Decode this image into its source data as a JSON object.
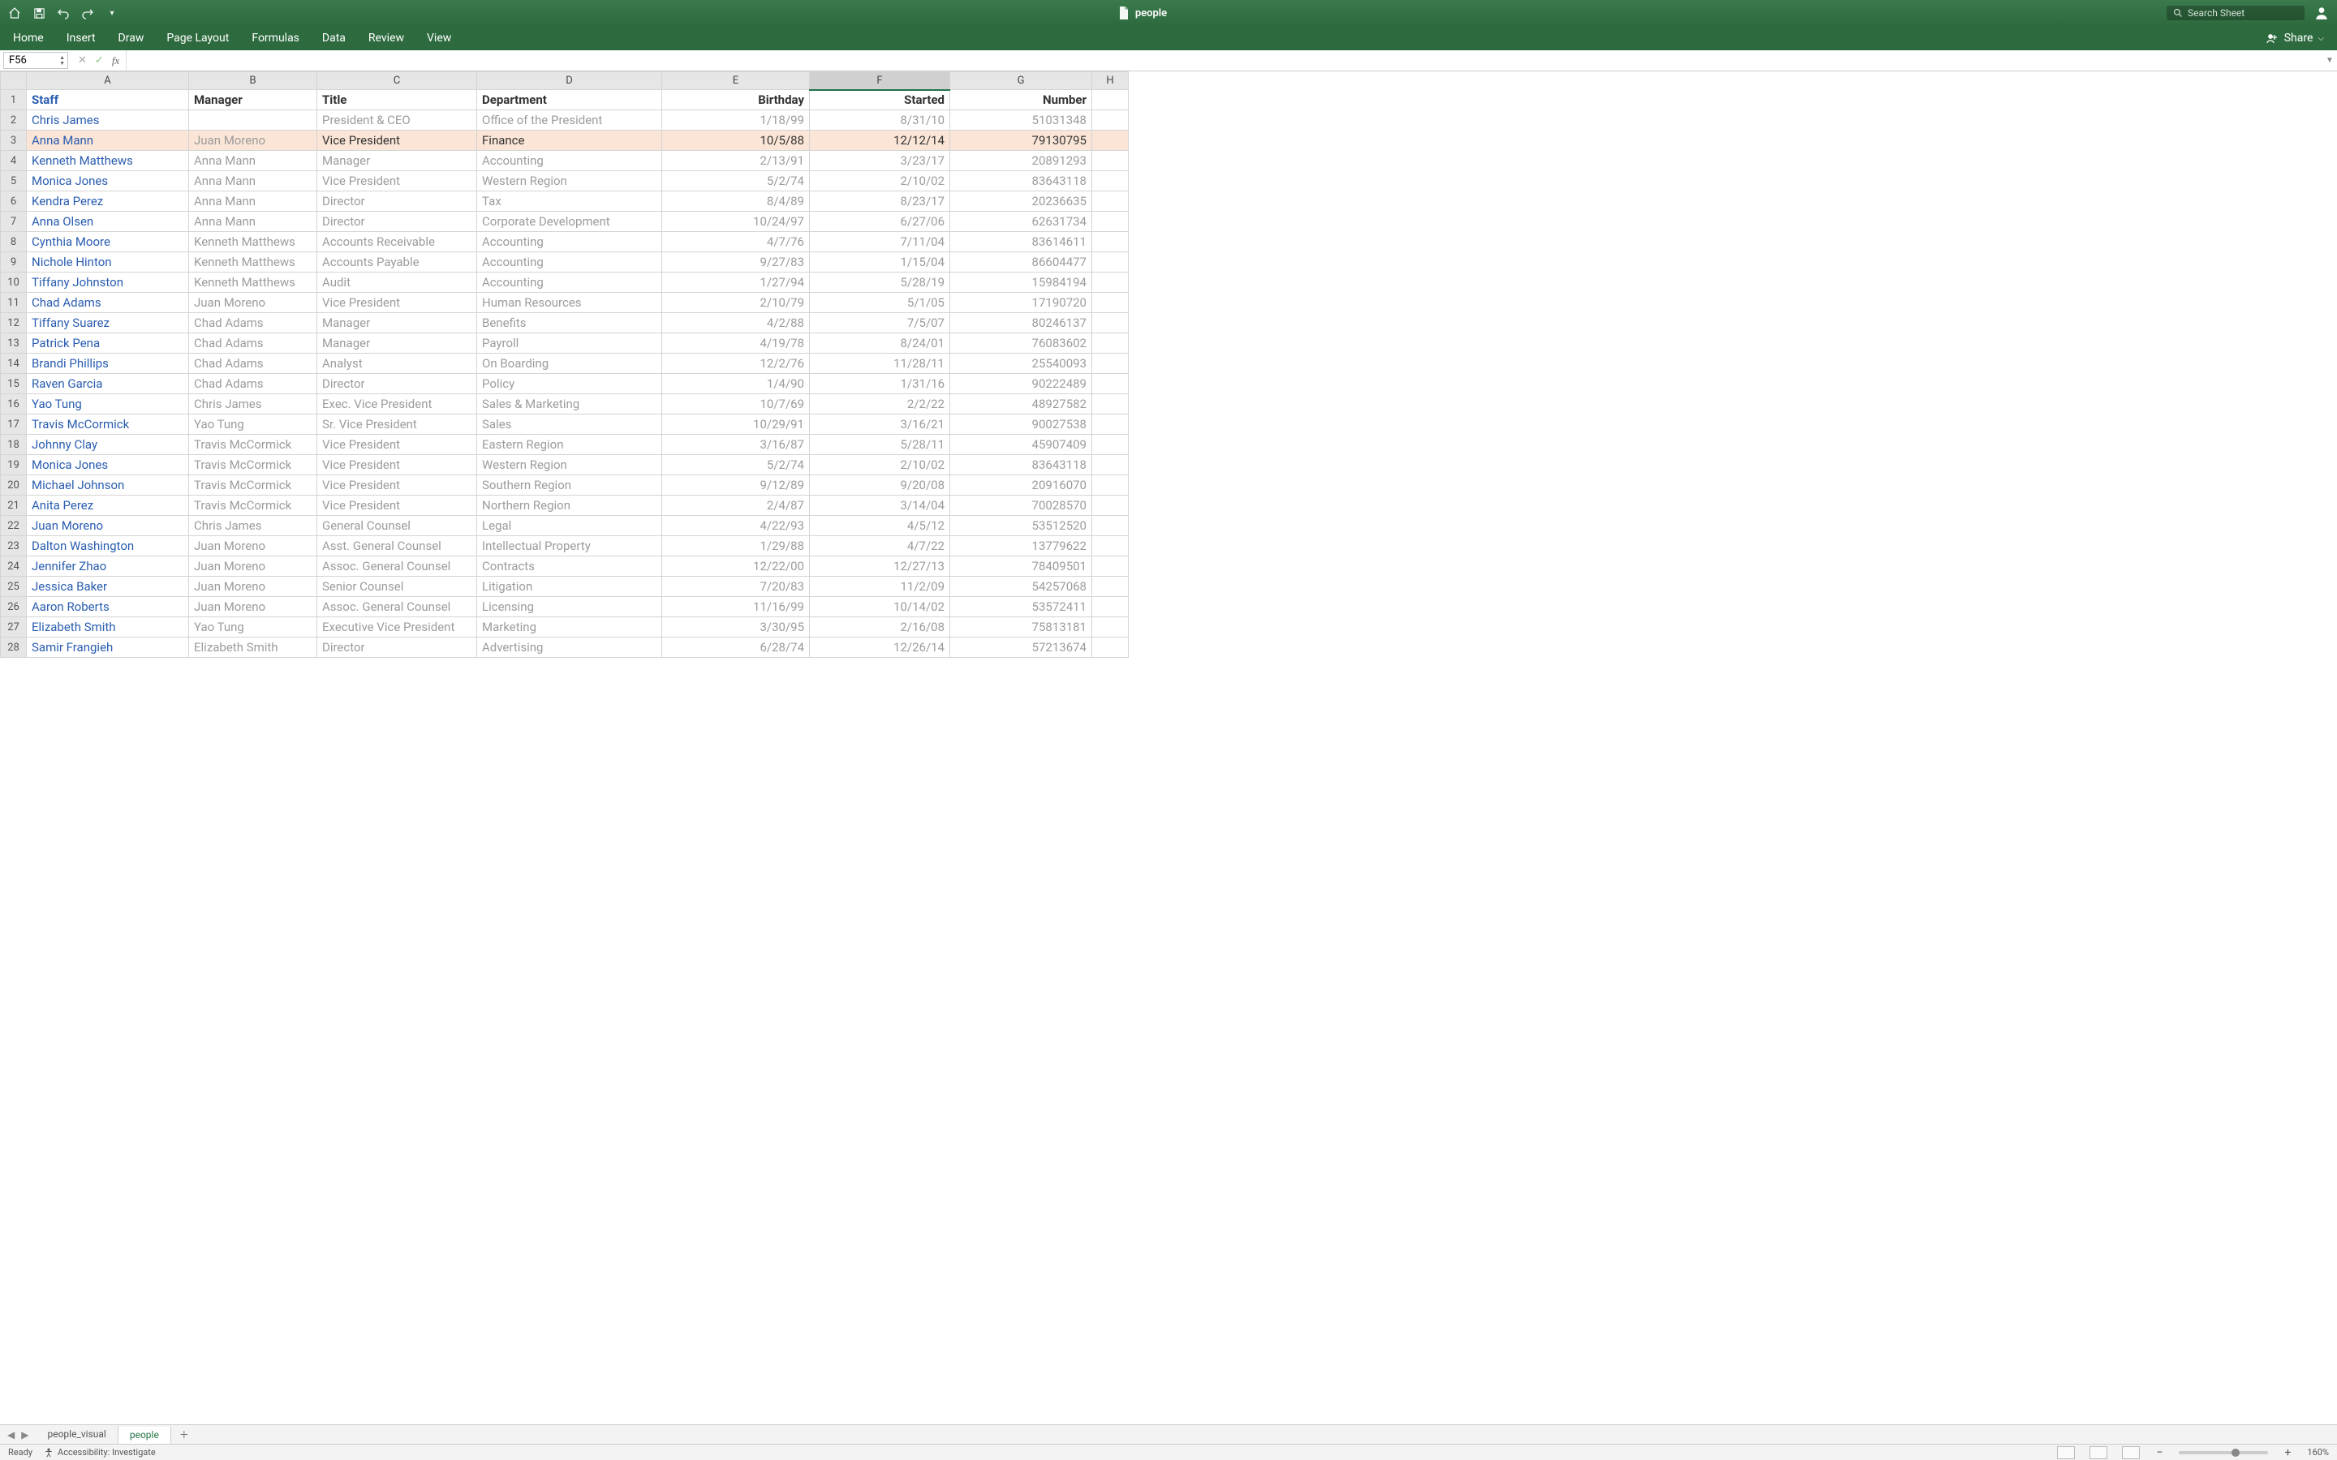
{
  "title": "people",
  "search_placeholder": "Search Sheet",
  "ribbon": [
    "Home",
    "Insert",
    "Draw",
    "Page Layout",
    "Formulas",
    "Data",
    "Review",
    "View"
  ],
  "share_label": "Share",
  "name_box": "F56",
  "columns": [
    "A",
    "B",
    "C",
    "D",
    "E",
    "F",
    "G",
    "H"
  ],
  "selected_column_index": 5,
  "highlighted_row_index": 1,
  "headers": {
    "staff": "Staff",
    "manager": "Manager",
    "title": "Title",
    "department": "Department",
    "birthday": "Birthday",
    "started": "Started",
    "number": "Number"
  },
  "rows": [
    {
      "n": 2,
      "staff": "Chris James",
      "manager": "",
      "title": "President & CEO",
      "dept": "Office of the President",
      "bday": "1/18/99",
      "started": "8/31/10",
      "num": "51031348"
    },
    {
      "n": 3,
      "staff": "Anna Mann",
      "manager": "Juan Moreno",
      "title": "Vice President",
      "dept": "Finance",
      "bday": "10/5/88",
      "started": "12/12/14",
      "num": "79130795"
    },
    {
      "n": 4,
      "staff": "Kenneth Matthews",
      "manager": "Anna Mann",
      "title": "Manager",
      "dept": "Accounting",
      "bday": "2/13/91",
      "started": "3/23/17",
      "num": "20891293"
    },
    {
      "n": 5,
      "staff": "Monica Jones",
      "manager": "Anna Mann",
      "title": "Vice President",
      "dept": "Western Region",
      "bday": "5/2/74",
      "started": "2/10/02",
      "num": "83643118"
    },
    {
      "n": 6,
      "staff": "Kendra Perez",
      "manager": "Anna Mann",
      "title": "Director",
      "dept": "Tax",
      "bday": "8/4/89",
      "started": "8/23/17",
      "num": "20236635"
    },
    {
      "n": 7,
      "staff": "Anna Olsen",
      "manager": "Anna Mann",
      "title": "Director",
      "dept": "Corporate Development",
      "bday": "10/24/97",
      "started": "6/27/06",
      "num": "62631734"
    },
    {
      "n": 8,
      "staff": "Cynthia Moore",
      "manager": "Kenneth Matthews",
      "title": "Accounts Receivable",
      "dept": "Accounting",
      "bday": "4/7/76",
      "started": "7/11/04",
      "num": "83614611"
    },
    {
      "n": 9,
      "staff": "Nichole Hinton",
      "manager": "Kenneth Matthews",
      "title": "Accounts Payable",
      "dept": "Accounting",
      "bday": "9/27/83",
      "started": "1/15/04",
      "num": "86604477"
    },
    {
      "n": 10,
      "staff": "Tiffany Johnston",
      "manager": "Kenneth Matthews",
      "title": "Audit",
      "dept": "Accounting",
      "bday": "1/27/94",
      "started": "5/28/19",
      "num": "15984194"
    },
    {
      "n": 11,
      "staff": "Chad Adams",
      "manager": "Juan Moreno",
      "title": "Vice President",
      "dept": "Human Resources",
      "bday": "2/10/79",
      "started": "5/1/05",
      "num": "17190720"
    },
    {
      "n": 12,
      "staff": "Tiffany Suarez",
      "manager": "Chad Adams",
      "title": "Manager",
      "dept": "Benefits",
      "bday": "4/2/88",
      "started": "7/5/07",
      "num": "80246137"
    },
    {
      "n": 13,
      "staff": "Patrick Pena",
      "manager": "Chad Adams",
      "title": "Manager",
      "dept": "Payroll",
      "bday": "4/19/78",
      "started": "8/24/01",
      "num": "76083602"
    },
    {
      "n": 14,
      "staff": "Brandi Phillips",
      "manager": "Chad Adams",
      "title": "Analyst",
      "dept": "On Boarding",
      "bday": "12/2/76",
      "started": "11/28/11",
      "num": "25540093"
    },
    {
      "n": 15,
      "staff": "Raven Garcia",
      "manager": "Chad Adams",
      "title": "Director",
      "dept": "Policy",
      "bday": "1/4/90",
      "started": "1/31/16",
      "num": "90222489"
    },
    {
      "n": 16,
      "staff": "Yao Tung",
      "manager": "Chris James",
      "title": "Exec. Vice President",
      "dept": "Sales & Marketing",
      "bday": "10/7/69",
      "started": "2/2/22",
      "num": "48927582"
    },
    {
      "n": 17,
      "staff": "Travis McCormick",
      "manager": "Yao Tung",
      "title": "Sr. Vice President",
      "dept": "Sales",
      "bday": "10/29/91",
      "started": "3/16/21",
      "num": "90027538"
    },
    {
      "n": 18,
      "staff": "Johnny Clay",
      "manager": "Travis McCormick",
      "title": "Vice President",
      "dept": "Eastern Region",
      "bday": "3/16/87",
      "started": "5/28/11",
      "num": "45907409"
    },
    {
      "n": 19,
      "staff": "Monica Jones",
      "manager": "Travis McCormick",
      "title": "Vice President",
      "dept": "Western Region",
      "bday": "5/2/74",
      "started": "2/10/02",
      "num": "83643118"
    },
    {
      "n": 20,
      "staff": "Michael Johnson",
      "manager": "Travis McCormick",
      "title": "Vice President",
      "dept": "Southern Region",
      "bday": "9/12/89",
      "started": "9/20/08",
      "num": "20916070"
    },
    {
      "n": 21,
      "staff": "Anita Perez",
      "manager": "Travis McCormick",
      "title": "Vice President",
      "dept": "Northern Region",
      "bday": "2/4/87",
      "started": "3/14/04",
      "num": "70028570"
    },
    {
      "n": 22,
      "staff": "Juan Moreno",
      "manager": "Chris James",
      "title": "General Counsel",
      "dept": "Legal",
      "bday": "4/22/93",
      "started": "4/5/12",
      "num": "53512520"
    },
    {
      "n": 23,
      "staff": "Dalton Washington",
      "manager": "Juan Moreno",
      "title": "Asst. General Counsel",
      "dept": "Intellectual Property",
      "bday": "1/29/88",
      "started": "4/7/22",
      "num": "13779622"
    },
    {
      "n": 24,
      "staff": "Jennifer Zhao",
      "manager": "Juan Moreno",
      "title": "Assoc. General Counsel",
      "dept": "Contracts",
      "bday": "12/22/00",
      "started": "12/27/13",
      "num": "78409501"
    },
    {
      "n": 25,
      "staff": "Jessica Baker",
      "manager": "Juan Moreno",
      "title": "Senior Counsel",
      "dept": "Litigation",
      "bday": "7/20/83",
      "started": "11/2/09",
      "num": "54257068"
    },
    {
      "n": 26,
      "staff": "Aaron Roberts",
      "manager": "Juan Moreno",
      "title": "Assoc. General Counsel",
      "dept": "Licensing",
      "bday": "11/16/99",
      "started": "10/14/02",
      "num": "53572411"
    },
    {
      "n": 27,
      "staff": "Elizabeth Smith",
      "manager": "Yao Tung",
      "title": "Executive Vice President",
      "dept": "Marketing",
      "bday": "3/30/95",
      "started": "2/16/08",
      "num": "75813181"
    },
    {
      "n": 28,
      "staff": "Samir Frangieh",
      "manager": "Elizabeth Smith",
      "title": "Director",
      "dept": "Advertising",
      "bday": "6/28/74",
      "started": "12/26/14",
      "num": "57213674"
    }
  ],
  "sheets": [
    "people_visual",
    "people"
  ],
  "active_sheet_index": 1,
  "status": {
    "ready": "Ready",
    "accessibility": "Accessibility: Investigate",
    "zoom": "160%"
  }
}
